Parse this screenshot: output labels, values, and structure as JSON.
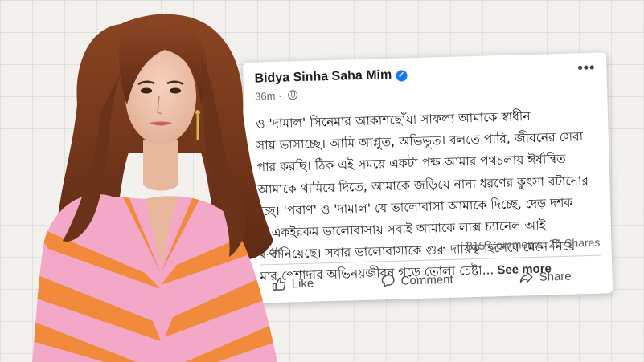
{
  "post": {
    "author": "Bidya Sinha Saha Mim",
    "time": "36m",
    "text_lines": [
      "ও 'দামাল' সিনেমার আকাশছোঁয়া সাফল্য আমাকে স্বাধীন",
      "সায় ভাসাচ্ছে। আমি আপ্লুত, অভিভূত। বলতে পারি, জীবনের সেরা",
      "পার করছি। ঠিক এই সময়ে একটা পক্ষ আমার পথচলায় ঈর্ষান্বিত",
      "আমাকে থামিয়ে দিতে, আমাকে জড়িয়ে নানা ধরণের কুৎসা রটানোর",
      "চ্ছে। 'পরাণ' ও 'দামাল' যে ভালোবাসা আমাকে দিচ্ছে, দেড় দশক",
      "ক একইরকম ভালোবাসায় সবাই আমাকে লাক্স চ্যানেল আই",
      "র বানিয়েছে। সবার ভালোবাসাকে গুরু দায়িত্ব হিসেবে মেনে নিয়ে",
      "মার পেশাদার অভিনয়জীবন গড়ে তোলা চেষ্টা..."
    ],
    "see_more": "See more",
    "reactions": "8.4K",
    "comments": "815 Comments",
    "shares": "26 Shares"
  },
  "actions": {
    "like": "Like",
    "comment": "Comment",
    "share": "Share"
  },
  "colors": {
    "verified": "#1877f2",
    "dress_orange": "#f28a3c",
    "dress_pink": "#f3a8c8",
    "hair": "#7a3a1e"
  }
}
